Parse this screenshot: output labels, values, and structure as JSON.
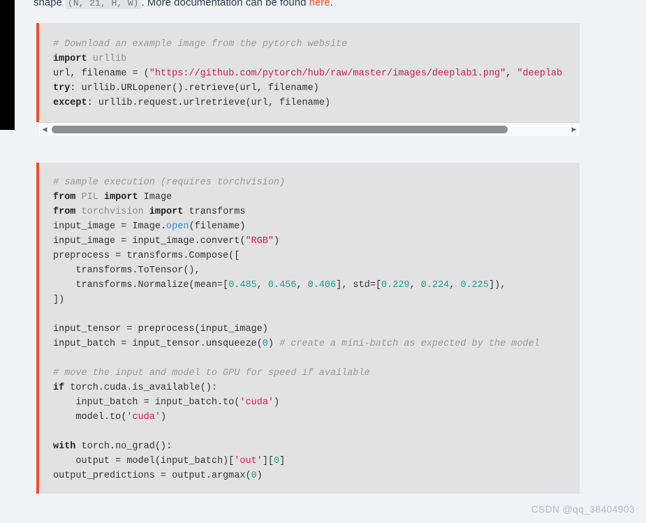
{
  "page": {
    "background_color": "#f1f2f6",
    "watermark": "CSDN @qq_38404903"
  },
  "intro_paragraph": {
    "text_before": "shape ",
    "inline_code": "(N, 21, H, W)",
    "text_middle": ". More documentation can be found ",
    "link_text": "here",
    "text_after": "."
  },
  "code_block_1": {
    "language": "python",
    "accent_color": "#ee4c2c",
    "background_color": "#e2e2e2",
    "scrollable": true,
    "lines": [
      {
        "tokens": [
          {
            "t": "# Download an example image from the pytorch website",
            "c": "comment"
          }
        ]
      },
      {
        "tokens": [
          {
            "t": "import",
            "c": "keyword"
          },
          {
            "t": " ",
            "c": "plain"
          },
          {
            "t": "urllib",
            "c": "module"
          }
        ]
      },
      {
        "tokens": [
          {
            "t": "url, filename = (",
            "c": "plain"
          },
          {
            "t": "\"https://github.com/pytorch/hub/raw/master/images/deeplab1.png\"",
            "c": "string"
          },
          {
            "t": ", ",
            "c": "plain"
          },
          {
            "t": "\"deeplab",
            "c": "string"
          }
        ]
      },
      {
        "tokens": [
          {
            "t": "try",
            "c": "keyword"
          },
          {
            "t": ": urllib.URLopener().retrieve(url, filename)",
            "c": "plain"
          }
        ]
      },
      {
        "tokens": [
          {
            "t": "except",
            "c": "keyword"
          },
          {
            "t": ": urllib.request.urlretrieve(url, filename)",
            "c": "plain"
          }
        ]
      }
    ],
    "scrollbar": {
      "left_arrow": "◀",
      "right_arrow": "▶",
      "thumb_percent": 88
    }
  },
  "code_block_2": {
    "language": "python",
    "accent_color": "#ee4c2c",
    "background_color": "#e2e2e2",
    "scrollable": false,
    "lines": [
      {
        "tokens": [
          {
            "t": "# sample execution (requires torchvision)",
            "c": "comment"
          }
        ]
      },
      {
        "tokens": [
          {
            "t": "from",
            "c": "keyword"
          },
          {
            "t": " ",
            "c": "plain"
          },
          {
            "t": "PIL",
            "c": "module"
          },
          {
            "t": " ",
            "c": "plain"
          },
          {
            "t": "import",
            "c": "keyword"
          },
          {
            "t": " ",
            "c": "plain"
          },
          {
            "t": "Image",
            "c": "plain"
          }
        ]
      },
      {
        "tokens": [
          {
            "t": "from",
            "c": "keyword"
          },
          {
            "t": " ",
            "c": "plain"
          },
          {
            "t": "torchvision",
            "c": "module"
          },
          {
            "t": " ",
            "c": "plain"
          },
          {
            "t": "import",
            "c": "keyword"
          },
          {
            "t": " ",
            "c": "plain"
          },
          {
            "t": "transforms",
            "c": "plain"
          }
        ]
      },
      {
        "tokens": [
          {
            "t": "input_image = Image.",
            "c": "plain"
          },
          {
            "t": "open",
            "c": "func"
          },
          {
            "t": "(filename)",
            "c": "plain"
          }
        ]
      },
      {
        "tokens": [
          {
            "t": "input_image = input_image.convert(",
            "c": "plain"
          },
          {
            "t": "\"RGB\"",
            "c": "string"
          },
          {
            "t": ")",
            "c": "plain"
          }
        ]
      },
      {
        "tokens": [
          {
            "t": "preprocess = transforms.Compose([",
            "c": "plain"
          }
        ]
      },
      {
        "tokens": [
          {
            "t": "    transforms.ToTensor(),",
            "c": "plain"
          }
        ]
      },
      {
        "tokens": [
          {
            "t": "    transforms.Normalize(mean=[",
            "c": "plain"
          },
          {
            "t": "0.485",
            "c": "number"
          },
          {
            "t": ", ",
            "c": "plain"
          },
          {
            "t": "0.456",
            "c": "number"
          },
          {
            "t": ", ",
            "c": "plain"
          },
          {
            "t": "0.406",
            "c": "number"
          },
          {
            "t": "], std=[",
            "c": "plain"
          },
          {
            "t": "0.229",
            "c": "number"
          },
          {
            "t": ", ",
            "c": "plain"
          },
          {
            "t": "0.224",
            "c": "number"
          },
          {
            "t": ", ",
            "c": "plain"
          },
          {
            "t": "0.225",
            "c": "number"
          },
          {
            "t": "]),",
            "c": "plain"
          }
        ]
      },
      {
        "tokens": [
          {
            "t": "])",
            "c": "plain"
          }
        ]
      },
      {
        "tokens": [
          {
            "t": "",
            "c": "plain"
          }
        ]
      },
      {
        "tokens": [
          {
            "t": "input_tensor = preprocess(input_image)",
            "c": "plain"
          }
        ]
      },
      {
        "tokens": [
          {
            "t": "input_batch = input_tensor.unsqueeze(",
            "c": "plain"
          },
          {
            "t": "0",
            "c": "number"
          },
          {
            "t": ") ",
            "c": "plain"
          },
          {
            "t": "# create a mini-batch as expected by the model",
            "c": "comment"
          }
        ]
      },
      {
        "tokens": [
          {
            "t": "",
            "c": "plain"
          }
        ]
      },
      {
        "tokens": [
          {
            "t": "# move the input and model to GPU for speed if available",
            "c": "comment"
          }
        ]
      },
      {
        "tokens": [
          {
            "t": "if",
            "c": "keyword"
          },
          {
            "t": " torch.cuda.is_available():",
            "c": "plain"
          }
        ]
      },
      {
        "tokens": [
          {
            "t": "    input_batch = input_batch.to(",
            "c": "plain"
          },
          {
            "t": "'cuda'",
            "c": "string"
          },
          {
            "t": ")",
            "c": "plain"
          }
        ]
      },
      {
        "tokens": [
          {
            "t": "    model.to(",
            "c": "plain"
          },
          {
            "t": "'cuda'",
            "c": "string"
          },
          {
            "t": ")",
            "c": "plain"
          }
        ]
      },
      {
        "tokens": [
          {
            "t": "",
            "c": "plain"
          }
        ]
      },
      {
        "tokens": [
          {
            "t": "with",
            "c": "keyword"
          },
          {
            "t": " torch.no_grad():",
            "c": "plain"
          }
        ]
      },
      {
        "tokens": [
          {
            "t": "    output = model(input_batch)[",
            "c": "plain"
          },
          {
            "t": "'out'",
            "c": "string"
          },
          {
            "t": "][",
            "c": "plain"
          },
          {
            "t": "0",
            "c": "number"
          },
          {
            "t": "]",
            "c": "plain"
          }
        ]
      },
      {
        "tokens": [
          {
            "t": "output_predictions = output.argmax(",
            "c": "plain"
          },
          {
            "t": "0",
            "c": "number"
          },
          {
            "t": ")",
            "c": "plain"
          }
        ]
      }
    ]
  }
}
